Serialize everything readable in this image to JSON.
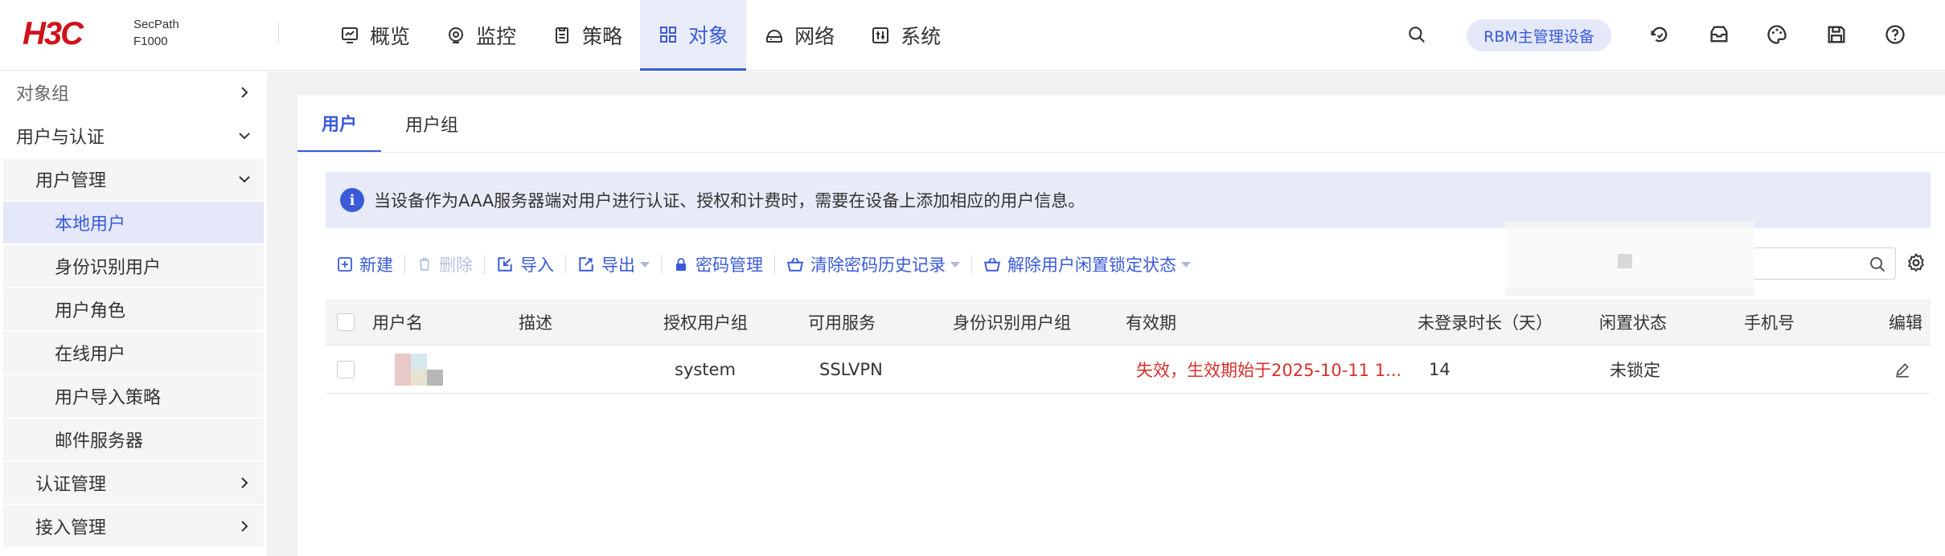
{
  "brand": {
    "logo": "H3C",
    "product_line": "SecPath",
    "model": "F1000",
    "color": "#d0121b"
  },
  "accent_color": "#3a5bd9",
  "nav": [
    {
      "label": "概览",
      "icon": "chart-monitor-icon",
      "active": false
    },
    {
      "label": "监控",
      "icon": "monitor-eye-icon",
      "active": false
    },
    {
      "label": "策略",
      "icon": "policy-document-icon",
      "active": false
    },
    {
      "label": "对象",
      "icon": "grid-objects-icon",
      "active": true
    },
    {
      "label": "网络",
      "icon": "router-icon",
      "active": false
    },
    {
      "label": "系统",
      "icon": "system-panel-icon",
      "active": false
    }
  ],
  "topright": {
    "search_icon": "search-icon",
    "rbm_badge": "RBM主管理设备",
    "icons": [
      "refresh-save-icon",
      "inbox-icon",
      "palette-icon",
      "save-disk-icon",
      "help-icon"
    ]
  },
  "sidebar": {
    "items": [
      {
        "label": "对象组",
        "level": 1,
        "expanded": false
      },
      {
        "label": "用户与认证",
        "level": 1,
        "expanded": true
      },
      {
        "label": "用户管理",
        "level": 2,
        "expanded": true
      },
      {
        "label": "本地用户",
        "level": 3,
        "active": true
      },
      {
        "label": "身份识别用户",
        "level": 3
      },
      {
        "label": "用户角色",
        "level": 3
      },
      {
        "label": "在线用户",
        "level": 3
      },
      {
        "label": "用户导入策略",
        "level": 3
      },
      {
        "label": "邮件服务器",
        "level": 3
      },
      {
        "label": "认证管理",
        "level": 2,
        "expanded": false
      },
      {
        "label": "接入管理",
        "level": 2,
        "expanded": false
      }
    ]
  },
  "tabs": [
    {
      "label": "用户",
      "active": true
    },
    {
      "label": "用户组",
      "active": false
    }
  ],
  "info": {
    "text": "当设备作为AAA服务器端对用户进行认证、授权和计费时，需要在设备上添加相应的用户信息。"
  },
  "toolbar": {
    "new": "新建",
    "delete": "删除",
    "import": "导入",
    "export": "导出",
    "password_mgmt": "密码管理",
    "clear_history": "清除密码历史记录",
    "unlock_idle": "解除用户闲置锁定状态"
  },
  "table": {
    "columns": [
      "用户名",
      "描述",
      "授权用户组",
      "可用服务",
      "身份识别用户组",
      "有效期",
      "未登录时长（天）",
      "闲置状态",
      "手机号",
      "编辑"
    ],
    "rows": [
      {
        "username": "",
        "description": "",
        "auth_group": "system",
        "service": "SSLVPN",
        "identity_group": "",
        "validity": "失效，生效期始于2025-10-11 1...",
        "inactive_days": "14",
        "idle_status": "未锁定",
        "phone": ""
      }
    ]
  }
}
